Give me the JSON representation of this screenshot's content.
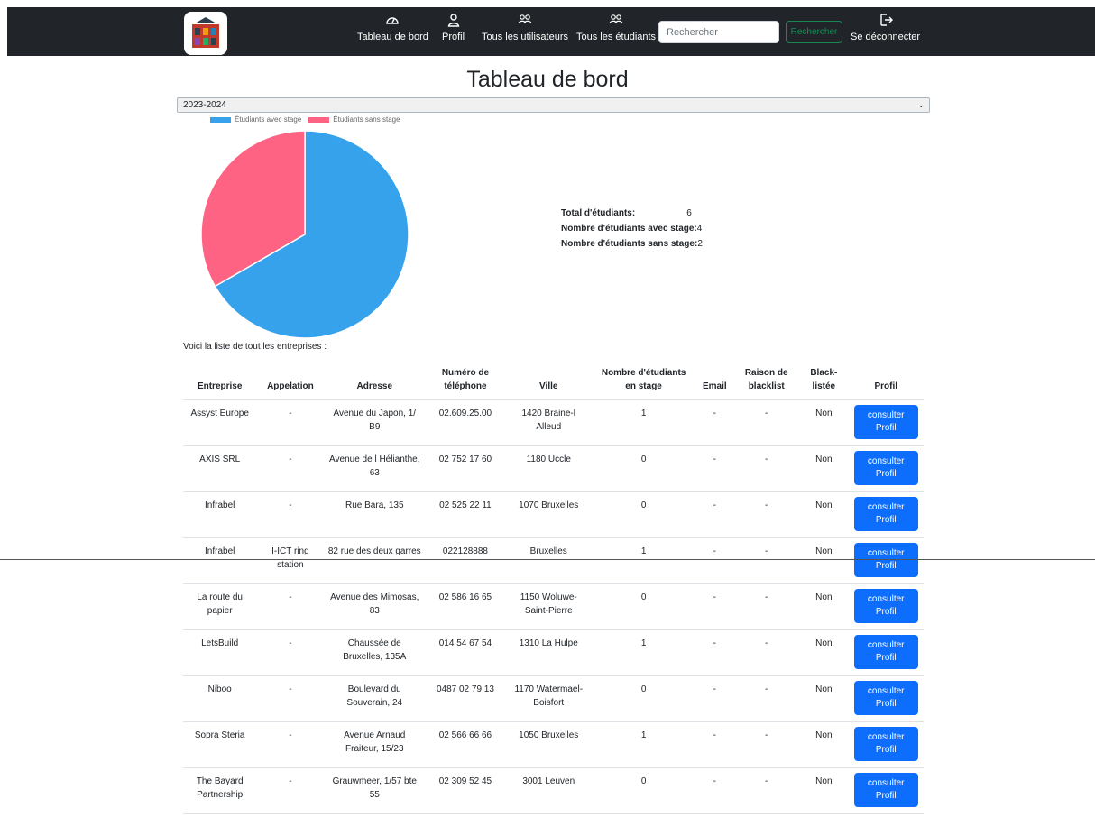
{
  "nav": {
    "items": [
      {
        "label": "Tableau de bord",
        "icon": "speedometer-icon"
      },
      {
        "label": "Profil",
        "icon": "person-icon"
      },
      {
        "label": "Tous les utilisateurs",
        "icon": "people-icon"
      },
      {
        "label": "Tous les étudiants",
        "icon": "people-icon"
      }
    ],
    "search_placeholder": "Rechercher",
    "search_button": "Rechercher",
    "logout_label": "Se déconnecter"
  },
  "page_title": "Tableau de bord",
  "year_select": {
    "value": "2023-2024"
  },
  "chart_data": {
    "type": "pie",
    "categories": [
      "Étudiants avec stage",
      "Étudiants sans stage"
    ],
    "values": [
      4,
      2
    ],
    "colors": [
      "#36a2eb",
      "#ff6384"
    ],
    "legend_position": "top-left"
  },
  "stats": {
    "total_label": "Total d'étudiants:",
    "total_value": "6",
    "with_label": "Nombre d'étudiants avec stage:",
    "with_value": "4",
    "without_label": "Nombre d'étudiants sans stage:",
    "without_value": "2"
  },
  "intro": "Voici la liste de tout les entreprises :",
  "table": {
    "headers": {
      "entreprise": "Entreprise",
      "appelation": "Appelation",
      "adresse": "Adresse",
      "tel_1": "Numéro de",
      "tel_2": "téléphone",
      "ville": "Ville",
      "nb_1": "Nombre d'étudiants",
      "nb_2": "en stage",
      "email": "Email",
      "raison_1": "Raison de",
      "raison_2": "blacklist",
      "black_1": "Black-",
      "black_2": "listée",
      "profil": "Profil"
    },
    "button_line1": "consulter",
    "button_line2": "Profil",
    "rows": [
      {
        "entreprise": "Assyst Europe",
        "appelation": "-",
        "adresse": "Avenue du Japon, 1/ B9",
        "tel": "02.609.25.00",
        "ville": "1420 Braine-l Alleud",
        "nb": "1",
        "email": "-",
        "raison": "-",
        "black": "Non"
      },
      {
        "entreprise": "AXIS SRL",
        "appelation": "-",
        "adresse": "Avenue de l Hélianthe, 63",
        "tel": "02 752 17 60",
        "ville": "1180 Uccle",
        "nb": "0",
        "email": "-",
        "raison": "-",
        "black": "Non"
      },
      {
        "entreprise": "Infrabel",
        "appelation": "-",
        "adresse": "Rue Bara, 135",
        "tel": "02 525 22 11",
        "ville": "1070 Bruxelles",
        "nb": "0",
        "email": "-",
        "raison": "-",
        "black": "Non"
      },
      {
        "entreprise": "Infrabel",
        "appelation": "I-ICT ring station",
        "adresse": "82 rue des deux garres",
        "tel": "022128888",
        "ville": "Bruxelles",
        "nb": "1",
        "email": "-",
        "raison": "-",
        "black": "Non"
      },
      {
        "entreprise": "La route du papier",
        "appelation": "-",
        "adresse": "Avenue des Mimosas, 83",
        "tel": "02 586 16 65",
        "ville": "1150 Woluwe-Saint-Pierre",
        "nb": "0",
        "email": "-",
        "raison": "-",
        "black": "Non"
      },
      {
        "entreprise": "LetsBuild",
        "appelation": "-",
        "adresse": "Chaussée de Bruxelles, 135A",
        "tel": "014 54 67 54",
        "ville": "1310 La Hulpe",
        "nb": "1",
        "email": "-",
        "raison": "-",
        "black": "Non"
      },
      {
        "entreprise": "Niboo",
        "appelation": "-",
        "adresse": "Boulevard du Souverain, 24",
        "tel": "0487 02 79 13",
        "ville": "1170 Watermael-Boisfort",
        "nb": "0",
        "email": "-",
        "raison": "-",
        "black": "Non"
      },
      {
        "entreprise": "Sopra Steria",
        "appelation": "-",
        "adresse": "Avenue Arnaud Fraiteur, 15/23",
        "tel": "02 566 66 66",
        "ville": "1050 Bruxelles",
        "nb": "1",
        "email": "-",
        "raison": "-",
        "black": "Non"
      },
      {
        "entreprise": "The Bayard Partnership",
        "appelation": "-",
        "adresse": "Grauwmeer, 1/57 bte 55",
        "tel": "02 309 52 45",
        "ville": "3001 Leuven",
        "nb": "0",
        "email": "-",
        "raison": "-",
        "black": "Non"
      }
    ]
  }
}
